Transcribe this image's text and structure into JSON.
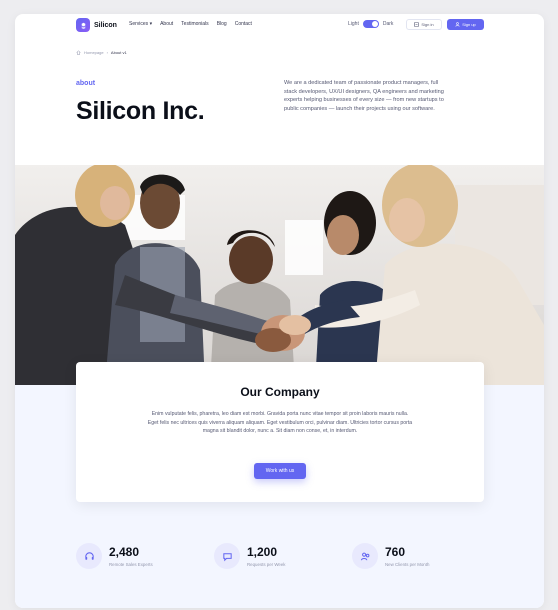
{
  "header": {
    "brand": "Silicon",
    "nav": [
      "Services",
      "About",
      "Testimonials",
      "Blog",
      "Contact"
    ],
    "theme_light": "Light",
    "theme_dark": "Dark",
    "signin": "Sign in",
    "signup": "Sign up"
  },
  "breadcrumb": {
    "home": "Homepage",
    "current": "About v1"
  },
  "hero": {
    "eyebrow": "about",
    "title": "Silicon Inc.",
    "description": "We are a dedicated team of passionate product managers, full stack developers, UX/UI designers, QA engineers and marketing experts helping businesses of every size — from new startups to public companies — launch their projects using our software."
  },
  "company": {
    "title": "Our Company",
    "text": "Enim vulputate felis, pharetra, leo diam est morbi. Gravida porta nunc vitae tempor sit proin laboris mauris nulla. Eget felis nec ultrices quis viverra aliquam aliquam. Eget vestibulum orci, pulvinar diam. Ultricies tortor cursus porta magna sit blandit dolor, nunc a. Sit diam non conse, et, in interdum.",
    "button": "Work with us"
  },
  "stats": [
    {
      "value": "2,480",
      "label": "Remote Sales Experts",
      "icon": "headset-icon"
    },
    {
      "value": "1,200",
      "label": "Requests per Week",
      "icon": "chat-icon"
    },
    {
      "value": "760",
      "label": "New Clients per Month",
      "icon": "users-icon"
    }
  ],
  "colors": {
    "primary": "#6366f1",
    "heading": "#0b0f19",
    "body": "#565973",
    "muted": "#9397ad",
    "stats_bg": "#f3f6ff"
  }
}
